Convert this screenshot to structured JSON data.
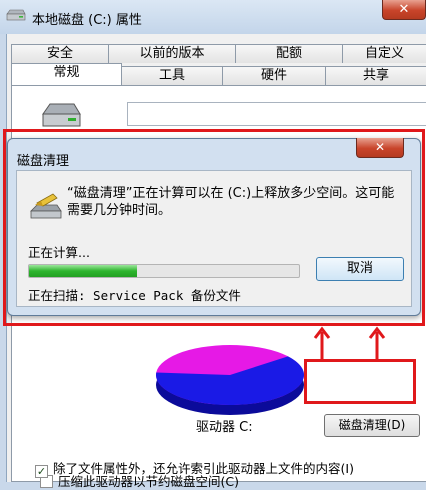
{
  "window": {
    "title": "本地磁盘 (C:) 属性",
    "close_glyph": "✕"
  },
  "tabs": {
    "row_back": [
      "安全",
      "以前的版本",
      "配额",
      "自定义"
    ],
    "row_front": [
      "常规",
      "工具",
      "硬件",
      "共享"
    ],
    "active": "常规"
  },
  "general": {
    "drive_label": "驱动器 C:",
    "cleanup_button": "磁盘清理(D)",
    "compress_label": "压缩此驱动器以节约磁盘空间(C)",
    "compress_checked": false,
    "index_label": "除了文件属性外，还允许索引此驱动器上文件的内容(I)",
    "index_checked": true,
    "pie": {
      "used_fraction": 0.62,
      "used_color": "#1a1ae6",
      "free_color": "#e619e6"
    }
  },
  "dialog": {
    "title": "磁盘清理",
    "message": "“磁盘清理”正在计算可以在 (C:)上释放多少空间。这可能需要几分钟时间。",
    "calc_label": "正在计算...",
    "progress_fraction": 0.4,
    "cancel_button": "取消",
    "scan_label": "正在扫描:  Service Pack 备份文件",
    "close_glyph": "✕"
  },
  "annotation_color": "#e0181b"
}
